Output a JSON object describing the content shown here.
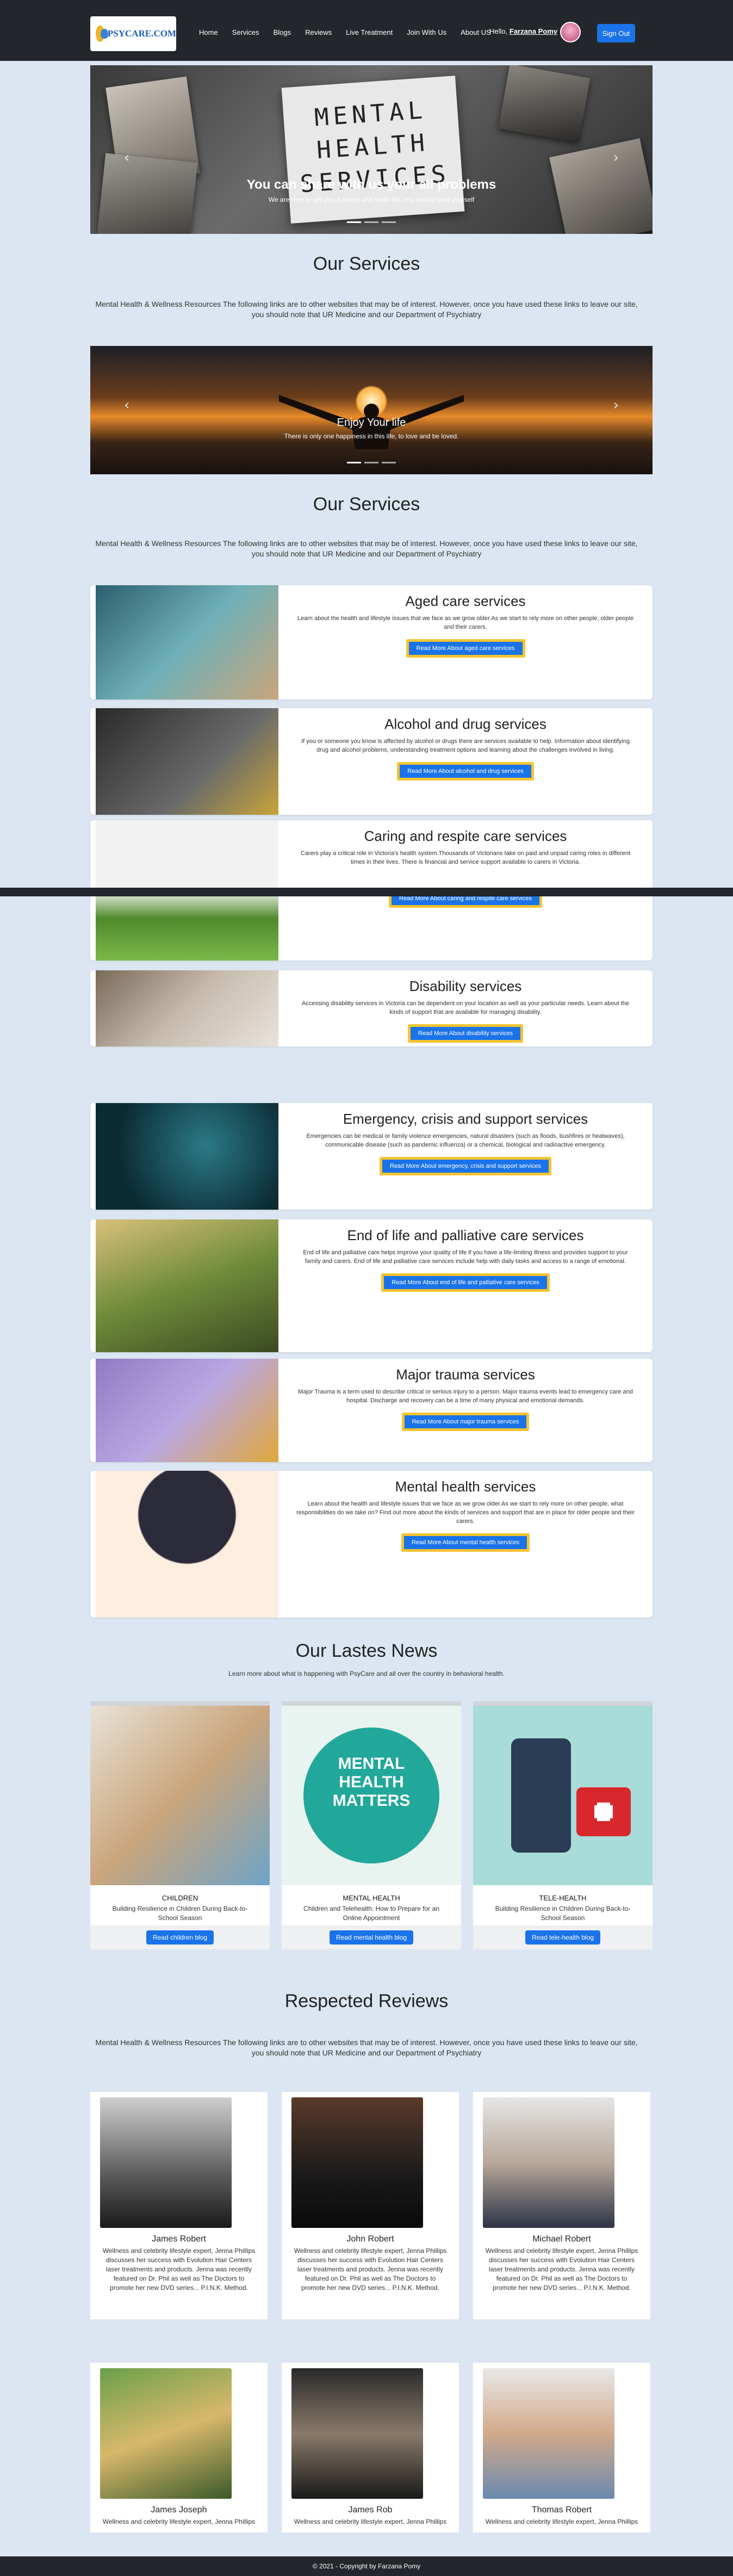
{
  "nav": {
    "logo": "PSYCARE.COM",
    "links": [
      "Home",
      "Services",
      "Blogs",
      "Reviews",
      "Live Treatment",
      "Join With Us",
      "About US"
    ],
    "tele_label": "Hello,",
    "tele_name": "Farzana Pomy",
    "signout": "Sign Out"
  },
  "carousel1": {
    "title": "You can share with us your all problems",
    "subtitle": "We are here to get you a peace and smile life. You should trust yourself",
    "card_text": "MENTAL HEALTH SERVICES"
  },
  "carousel2": {
    "title": "Enjoy Your life",
    "subtitle": "There is only one happiness in this life, to love and be loved."
  },
  "services_heading": "Our Services",
  "services_desc": "Mental Health & Wellness Resources The following links are to other websites that may be of interest. However, once you have used these links to leave our site, you should note that UR Medicine and our Department of Psychiatry",
  "services": [
    {
      "title": "Aged care services",
      "text": "Learn about the health and lifestyle issues that we face as we grow older.As we start to rely more on other people, older people and their carers.",
      "button": "Read More About aged care services"
    },
    {
      "title": "Alcohol and drug services",
      "text": "If you or someone you know is affected by alcohol or drugs there are services available to help. Information about identifying drug and alcohol problems, understanding treatment options and learning about the challenges involved in living.",
      "button": "Read More About alcohol and drug services"
    },
    {
      "title": "Caring and respite care services",
      "text": "Carers play a critical role in Victoria's health system.Thousands of Victorians take on paid and unpaid caring roles in different times in their lives. There is financial and service support available to carers in Victoria.",
      "button": "Read More About caring and respite care services"
    },
    {
      "title": "Disability services",
      "text": "Accessing disability services in Victoria can be dependent on your location as well as your particular needs. Learn about the kinds of support that are available for managing disability.",
      "button": "Read More About disability services"
    },
    {
      "title": "Emergency, crisis and support services",
      "text": "Emergencies can be medical or family violence emergencies, natural disasters (such as floods, bushfires or heatwaves), communicable disease (such as pandemic influenza) or a chemical, biological and radioactive emergency.",
      "button": "Read More About emergency, crisis and support services"
    },
    {
      "title": "End of life and palliative care services",
      "text": "End of life and palliative care helps improve your quality of life if you have a life-limiting illness and provides support to your family and carers. End of life and palliative care services include help with daily tasks and access to a range of emotional.",
      "button": "Read More About end of life and palliative care services"
    },
    {
      "title": "Major trauma services",
      "text": "Major Trauma is a term used to describe critical or serious injury to a person. Major trauma events lead to emergency care and hospital. Discharge and recovery can be a time of many physical and emotional demands.",
      "button": "Read More About major trauma services"
    },
    {
      "title": "Mental health services",
      "text": "Learn about the health and lifestyle issues that we face as we grow older.As we start to rely more on other people, what responsibilities do we take on? Find out more about the kinds of services and support that are in place for older people and their carers.",
      "button": "Read More About mental health services"
    }
  ],
  "news_heading": "Our Lastes News",
  "news_sub": "Learn more about what is happening with PsyCare and all over the country in behavioral health.",
  "news": [
    {
      "category": "CHILDREN",
      "text": "Building Resilience in Children During Back-to-School Season",
      "button": "Read children blog"
    },
    {
      "category": "MENTAL HEALTH",
      "text": "Children and Telehealth: How to Prepare for an Online Appointment",
      "button": "Read mental health blog",
      "poster": "MENTAL HEALTH MATTERS"
    },
    {
      "category": "TELE-HEALTH",
      "text": "Building Resilience in Children During Back-to-School Season",
      "button": "Read tele-health blog"
    }
  ],
  "reviews_heading": "Respected Reviews",
  "reviews_desc": "Mental Health & Wellness Resources The following links are to other websites that may be of interest. However, once you have used these links to leave our site, you should note that UR Medicine and our Department of Psychiatry",
  "reviews": [
    {
      "name": "James Robert",
      "text": "Wellness and celebrity lifestyle expert, Jenna Phillips discusses her success with Evolution Hair Centers laser treatments and products. Jenna was recently featured on Dr. Phil as well as The Doctors to promote her new DVD series... P.I.N.K. Method."
    },
    {
      "name": "John Robert",
      "text": "Wellness and celebrity lifestyle expert, Jenna Phillips discusses her success with Evolution Hair Centers laser treatments and products. Jenna was recently featured on Dr. Phil as well as The Doctors to promote her new DVD series... P.I.N.K. Method."
    },
    {
      "name": "Michael Robert",
      "text": "Wellness and celebrity lifestyle expert, Jenna Phillips discusses her success with Evolution Hair Centers laser treatments and products. Jenna was recently featured on Dr. Phil as well as The Doctors to promote her new DVD series... P.I.N.K. Method."
    },
    {
      "name": "James Joseph",
      "text": "Wellness and celebrity lifestyle expert, Jenna Phillips"
    },
    {
      "name": "James Rob",
      "text": "Wellness and celebrity lifestyle expert, Jenna Phillips"
    },
    {
      "name": "Thomas Robert",
      "text": "Wellness and celebrity lifestyle expert, Jenna Phillips"
    }
  ],
  "footer": "© 2021 - Copyright by Farzana Pomy"
}
